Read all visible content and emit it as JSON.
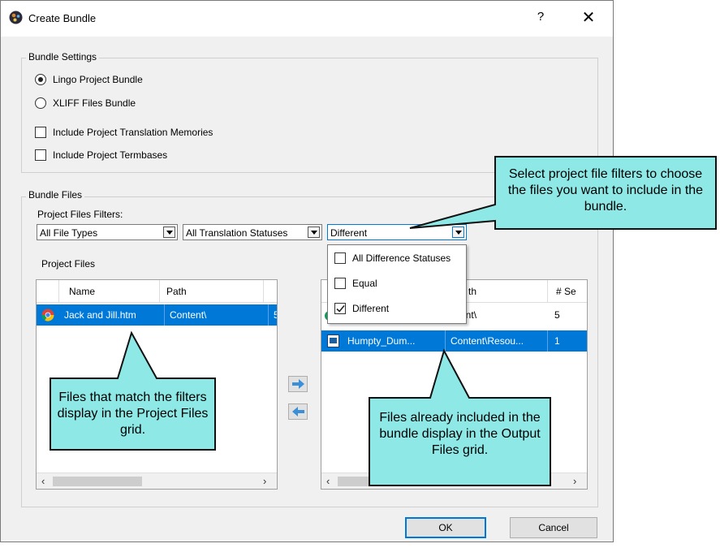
{
  "dialog": {
    "title": "Create Bundle",
    "help": "?",
    "close": "✕"
  },
  "bundle_settings": {
    "legend": "Bundle Settings",
    "options": [
      {
        "label": "Lingo Project Bundle",
        "selected": true
      },
      {
        "label": "XLIFF Files Bundle",
        "selected": false
      }
    ],
    "checks": [
      {
        "label": "Include Project Translation Memories",
        "checked": false
      },
      {
        "label": "Include Project Termbases",
        "checked": false
      }
    ]
  },
  "bundle_files": {
    "legend": "Bundle Files",
    "filters_label": "Project Files Filters:",
    "filters": [
      "All File Types",
      "All Translation Statuses",
      "Different"
    ],
    "dropdown_options": [
      {
        "label": "All Difference Statuses",
        "checked": false
      },
      {
        "label": "Equal",
        "checked": false
      },
      {
        "label": "Different",
        "checked": true
      }
    ],
    "project_files_label": "Project Files",
    "project_grid": {
      "columns": [
        "Name",
        "Path"
      ],
      "rows": [
        {
          "name": "Jack and Jill.htm",
          "path": "Content\\",
          "extra": "5"
        }
      ]
    },
    "output_grid": {
      "columns": [
        "th",
        "# Se"
      ],
      "rows": [
        {
          "name": "",
          "path": "ntent\\",
          "segments": "5"
        },
        {
          "name": "Humpty_Dum...",
          "path": "Content\\Resou...",
          "segments": "1"
        }
      ]
    }
  },
  "buttons": {
    "ok": "OK",
    "cancel": "Cancel"
  },
  "callouts": {
    "filters": "Select project file filters to choose the files you want to include in the bundle.",
    "project": "Files that match the filters display in the Project Files grid.",
    "output": "Files already included in the bundle display in the Output Files grid."
  },
  "colors": {
    "callout_fill": "#8ee8e6",
    "selection": "#0078d7",
    "arrow_blue": "#3b8fd9"
  }
}
